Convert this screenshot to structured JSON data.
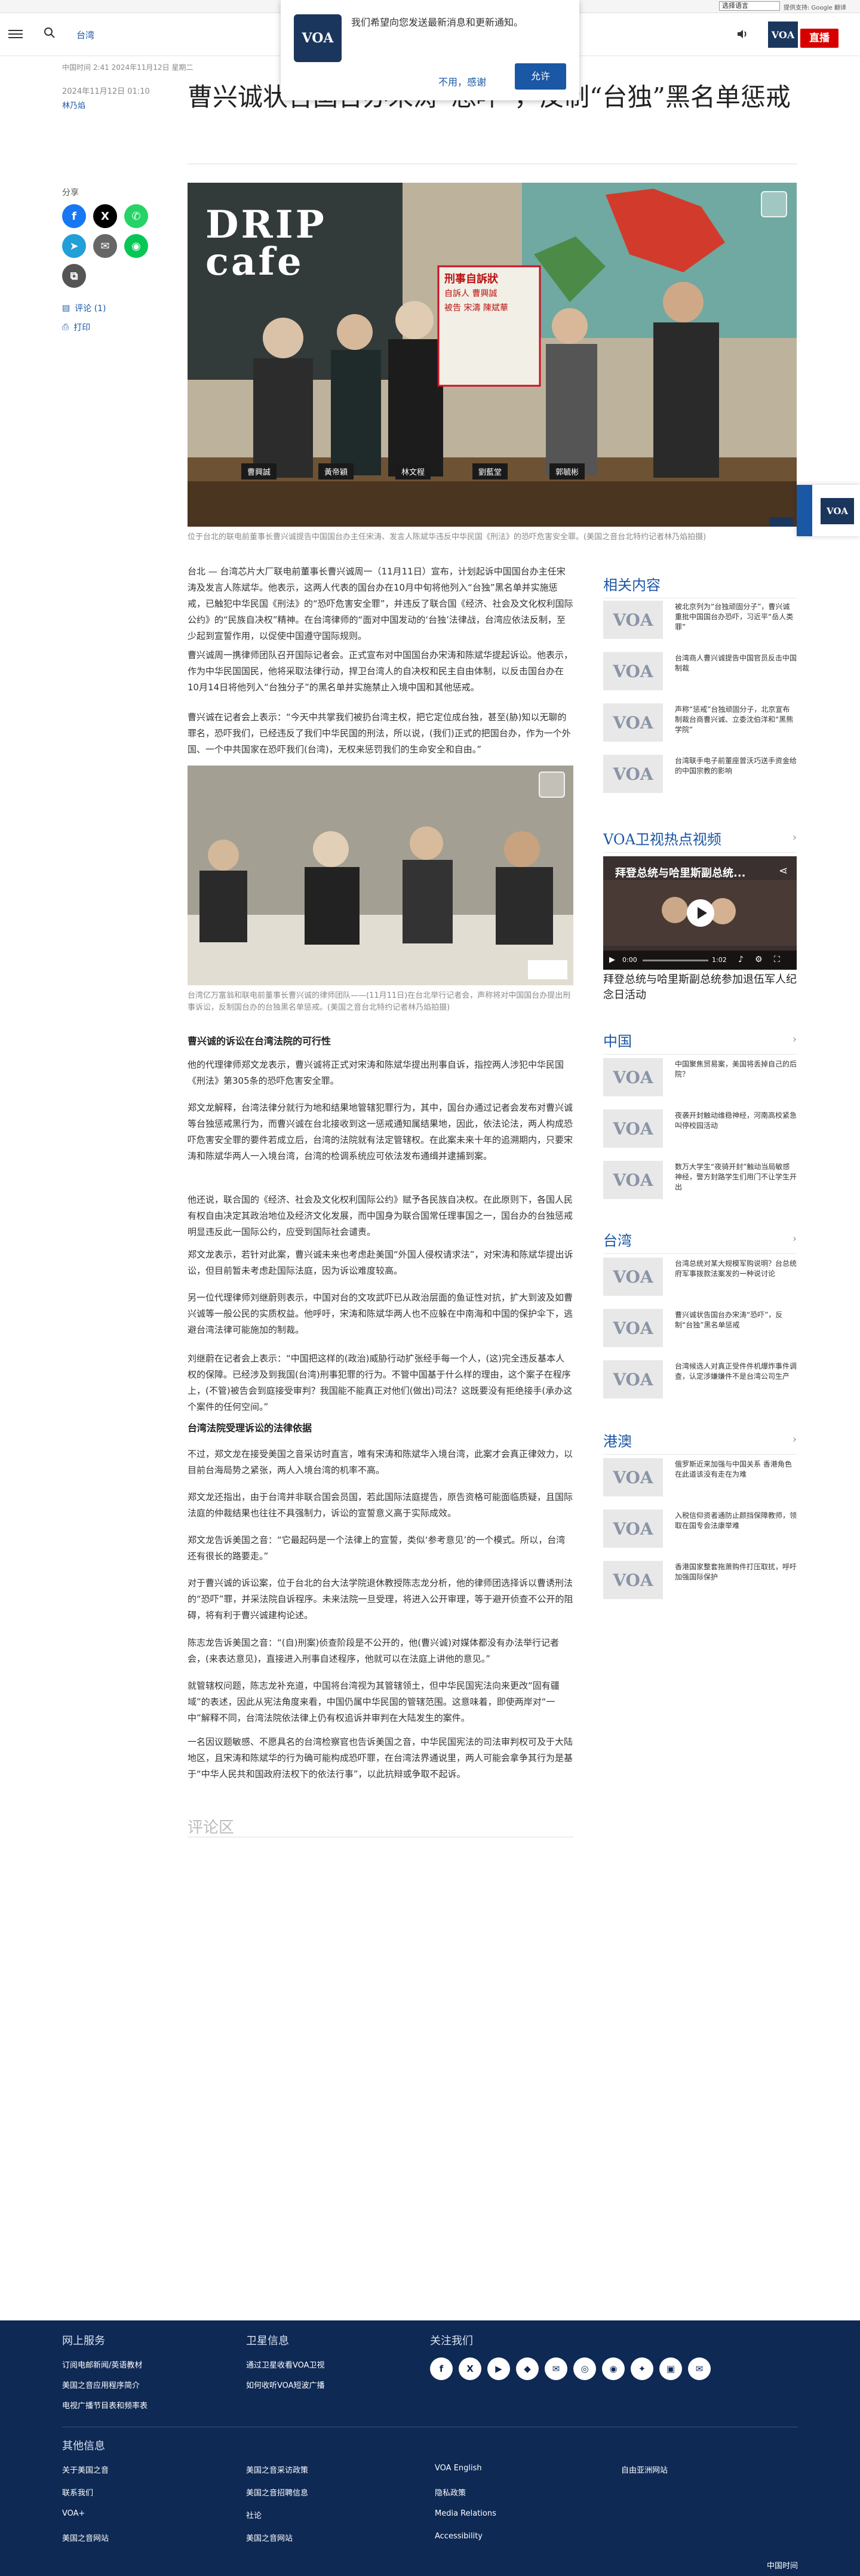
{
  "translate_bar": {
    "language_select": "选择语言",
    "powered_by": "提供支持: Google 翻译"
  },
  "header": {
    "region": "台湾",
    "logo": "VOA",
    "live_label": "直播"
  },
  "notification": {
    "logo": "VOA",
    "message": "我们希望向您发送最新消息和更新通知。",
    "decline": "不用，感谢",
    "allow": "允许"
  },
  "article": {
    "timestamp_line": "中国时间 2:41 2024年11月12日 星期二",
    "date": "2024年11月12日 01:10",
    "author": "林乃焰",
    "title": "曹兴诚状告国台办宋涛“恐吓”，反制“台独”黑名单惩戒",
    "share_label": "分享",
    "comments_link": "评论 (1)",
    "print_link": "打印",
    "hero_caption": "位于台北的联电前董事长曹兴诚提告中国国台办主任宋涛、发言人陈斌华违反中华民国《刑法》的恐吓危害安全罪。(美国之音台北特约记者林乃焰拍摄)",
    "hero_sign": {
      "line1": "刑事自訴狀",
      "line2": "自訴人 曹興誠",
      "line3": "被告 宋濤 陳斌華"
    },
    "hero_cafe": "DRIP cafe",
    "hero_nameplates": [
      "曹興誠",
      "黃帝穎",
      "林文程",
      "劉藍堂",
      "郭毓彬"
    ],
    "image2_caption": "台湾亿万富翁和联电前董事长曹兴诚的律师团队——(11月11日)在台北举行记者会，声称将对中国国台办提出刑事诉讼，反制国台办的台独黑名单惩戒。(美国之音台北特约记者林乃焰拍摄)",
    "paragraphs_a": [
      "台北 — 台湾芯片大厂联电前董事长曹兴诚周一（11月11日）宣布，计划起诉中国国台办主任宋涛及发言人陈斌华。他表示，这两人代表的国台办在10月中旬将他列入“台独”黑名单并实施惩戒，已触犯中华民国《刑法》的“恐吓危害安全罪”，并违反了联合国《经济、社会及文化权利国际公约》的“民族自决权”精神。在台湾律师的“面对中国发动的‘台独’法律战，台湾应依法反制，至少起到宣誓作用，以促使中国遵守国际规则。",
      "曹兴诚周一携律师团队召开国际记者会。正式宣布对中国国台办宋涛和陈斌华提起诉讼。他表示，作为中华民国国民，他将采取法律行动，捍卫台湾人的自决权和民主自由体制，以反击国台办在10月14日将他列入“台独分子”的黑名单并实施禁止入境中国和其他惩戒。",
      "曹兴诚在记者会上表示：“今天中共掌我们被扔台湾主权，把它定位成台独，甚至(胁)知以无聊的罪名，恐吓我们，已经违反了我们中华民国的刑法，所以说，(我们)正式的把国台办，作为一个外国、一个中共国家在恐吓我们(台湾)，无权来惩罚我们的生命安全和自由。”"
    ],
    "subhead_1": "曹兴诚的诉讼在台湾法院的可行性",
    "paragraphs_b": [
      "他的代理律师郑文龙表示，曹兴诚将正式对宋涛和陈斌华提出刑事自诉，指控两人涉犯中华民国《刑法》第305条的恐吓危害安全罪。",
      "郑文龙解释，台湾法律分就行为地和结果地管辖犯罪行为，其中，国台办通过记者会发布对曹兴诚等台独惩戒黑行为，而曹兴诚在台北接收到这一惩戒通知属结果地，因此，依法论法，两人构成恐吓危害安全罪的要件若成立后，台湾的法院就有法定管辖权。在此案未来十年的追溯期内，只要宋涛和陈斌华两人一入境台湾，台湾的检调系统应可依法发布通缉并逮捕到案。",
      "他还说，联合国的《经济、社会及文化权利国际公约》赋予各民族自决权。在此原则下，各国人民有权自由决定其政治地位及经济文化发展，而中国身为联合国常任理事国之一，国台办的台独惩戒明显违反此一国际公约，应受到国际社会谴责。",
      "郑文龙表示，若针对此案，曹兴诚未来也考虑赴美国“外国人侵权请求法”，对宋涛和陈斌华提出诉讼，但目前暂未考虑赴国际法庭，因为诉讼难度较高。",
      "另一位代理律师刘继蔚则表示，中国对台的文攻武吓已从政治层面的鱼证性对抗，扩大到波及如曹兴诚等一般公民的实质权益。他呼吁，宋涛和陈斌华两人也不应躲在中南海和中国的保护伞下，逃避台湾法律可能施加的制裁。",
      "刘继蔚在记者会上表示：“中国把这样的(政治)威胁行动扩张经手每一个人，(这)完全违反基本人权的保障。已经涉及到我国(台湾)刑事犯罪的行为。不管中国基于什么样的理由，这个案子在程序上，(不管)被告会到庭接受审判？我国能不能真正对他们(做出)司法？这既要没有拒绝接手(承办这个案件的任何空间。”"
    ],
    "subhead_2": "台湾法院受理诉讼的法律依据",
    "paragraphs_c": [
      "不过，郑文龙在接受美国之音采访时直言，唯有宋涛和陈斌华入境台湾，此案才会真正律效力，以目前台海局势之紧张，两人入境台湾的机率不高。",
      "郑文龙还指出，由于台湾并非联合国会员国，若此国际法庭提告，原告资格可能面临质疑，且国际法庭的仲裁结果也往往不具强制力，诉讼的宣誓意义高于实际成效。",
      "郑文龙告诉美国之音：“它最起码是一个法律上的宣誓，类似‘参考意见’的一个模式。所以，台湾还有很长的路要走。”",
      "对于曹兴诚的诉讼案，位于台北的台大法学院退休教授陈志龙分析，他的律师团选择诉以曹诱刑法的“恐吓”罪，并采法院自诉程序。未来法院一旦受理，将进入公开审理，等于避开侦查不公开的阻碍，将有利于曹兴诚建构论述。",
      "陈志龙告诉美国之音：“(自)刑案)侦查阶段是不公开的，他(曹兴诚)对媒体都没有办法举行记者会，(来表达意见)，直接进入刑事自述程序，他就可以在法庭上讲他的意见。”",
      "就管辖权问题，陈志龙补充道，中国将台湾视为其管辖领土，但中华民国宪法向来更改“固有疆域”的表述，因此从宪法角度来看，中国仍属中华民国的管辖范围。这意味着，即使两岸对“一中”解释不同，台湾法院依法律上仍有权追诉并审判在大陆发生的案件。",
      "一名因议题敏感、不愿具名的台湾检察官也告诉美国之音，中华民国宪法的司法审判权可及于大陆地区，且宋涛和陈斌华的行为确可能构成恐吓罪，在台湾法界通说里，两人可能会拿争其行为是基于“中华人民共和国政府法权下的依法行事”，以此抗辩或争取不起诉。"
    ],
    "comments_heading": "评论区"
  },
  "sidebar": {
    "related_heading": "相关内容",
    "related": [
      {
        "thumb": "VOA",
        "text": "被北京列为“台独顽固分子”，曹兴诚重批中国国台办恐吓，习近平“岳人类罪”"
      },
      {
        "thumb": "VOA",
        "text": "台湾商人曹兴诚提告中国官员反击中国制裁"
      },
      {
        "thumb": "VOA",
        "text": "声称“惩戒”台独顽固分子，北京宣布制裁台商曹兴诚、立委沈伯洋和“黑熊学院”"
      },
      {
        "thumb": "VOA",
        "text": "台湾联手电子前董座曾沃巧送手资金给的中国宗教的影响"
      }
    ],
    "video_heading": "VOA卫视热点视频",
    "video_overlay_title": "拜登总统与哈里斯副总统...",
    "video_time": "0:00",
    "video_duration": "1:02",
    "video_title": "拜登总统与哈里斯副总统参加退伍军人纪念日活动",
    "china_heading": "中国",
    "china": [
      {
        "thumb": "VOA",
        "text": "中国聚焦贸易案，美国将丢掉自己的后院？"
      },
      {
        "thumb": "VOA",
        "text": "夜袭开封触动维稳神经，河南高校紧急叫停校园活动"
      },
      {
        "thumb": "VOA",
        "text": "数万大学生“夜骑开封”触动当局敏感神经，警方封路学生们用门不让学生开出"
      }
    ],
    "taiwan_heading": "台湾",
    "taiwan": [
      {
        "thumb": "VOA",
        "text": "台湾总统对某大规模军购说明？台总统府军事拨款法案发的一种说讨论"
      },
      {
        "thumb": "VOA",
        "text": "曹兴诚状告国台办宋涛“恐吓”，反制“台独”黑名单惩戒"
      },
      {
        "thumb": "VOA",
        "text": "台湾候选人对真正受件件机爆炸事件调查，认定涉嫌嫌件不是台湾公司生产"
      }
    ],
    "hk_heading": "港澳",
    "hk": [
      {
        "thumb": "VOA",
        "text": "俄罗斯近来加强与中国关系 香港角色在此道该没有走在为难"
      },
      {
        "thumb": "VOA",
        "text": "入税信仰资者通防止颜挡保障教师，领取在国专会法康举难"
      },
      {
        "thumb": "VOA",
        "text": "香港国家整套拖萧购件打压取扰，呼吁加强国际保护"
      }
    ]
  },
  "footer": {
    "col1_heading": "网上服务",
    "col1": [
      "订阅电邮新闻/英语教材",
      "美国之音应用程序简介",
      "电视广播节目表和频率表"
    ],
    "col2_heading": "卫星信息",
    "col2": [
      "通过卫星收看VOA卫视",
      "如何收听VOA短波广播"
    ],
    "col3_heading": "关注我们",
    "social": [
      "f",
      "X",
      "▶",
      "◆",
      "✉",
      "◎",
      "◉",
      "✦",
      "▣",
      "✉"
    ],
    "more_heading": "其他信息",
    "links": [
      [
        "关于美国之音",
        "美国之音采访政策",
        "VOA English",
        "自由亚洲网站"
      ],
      [
        "联系我们",
        "美国之音招聘信息",
        "隐私政策",
        ""
      ],
      [
        "VOA+",
        "社论",
        "Media Relations",
        ""
      ],
      [
        "美国之音网站",
        "美国之音网站",
        "Accessibility",
        ""
      ]
    ],
    "time_label": "中国时间"
  },
  "colors": {
    "brand": "#1b365d",
    "link": "#1a57a5",
    "live": "#d60000",
    "footer": "#0e2954"
  }
}
